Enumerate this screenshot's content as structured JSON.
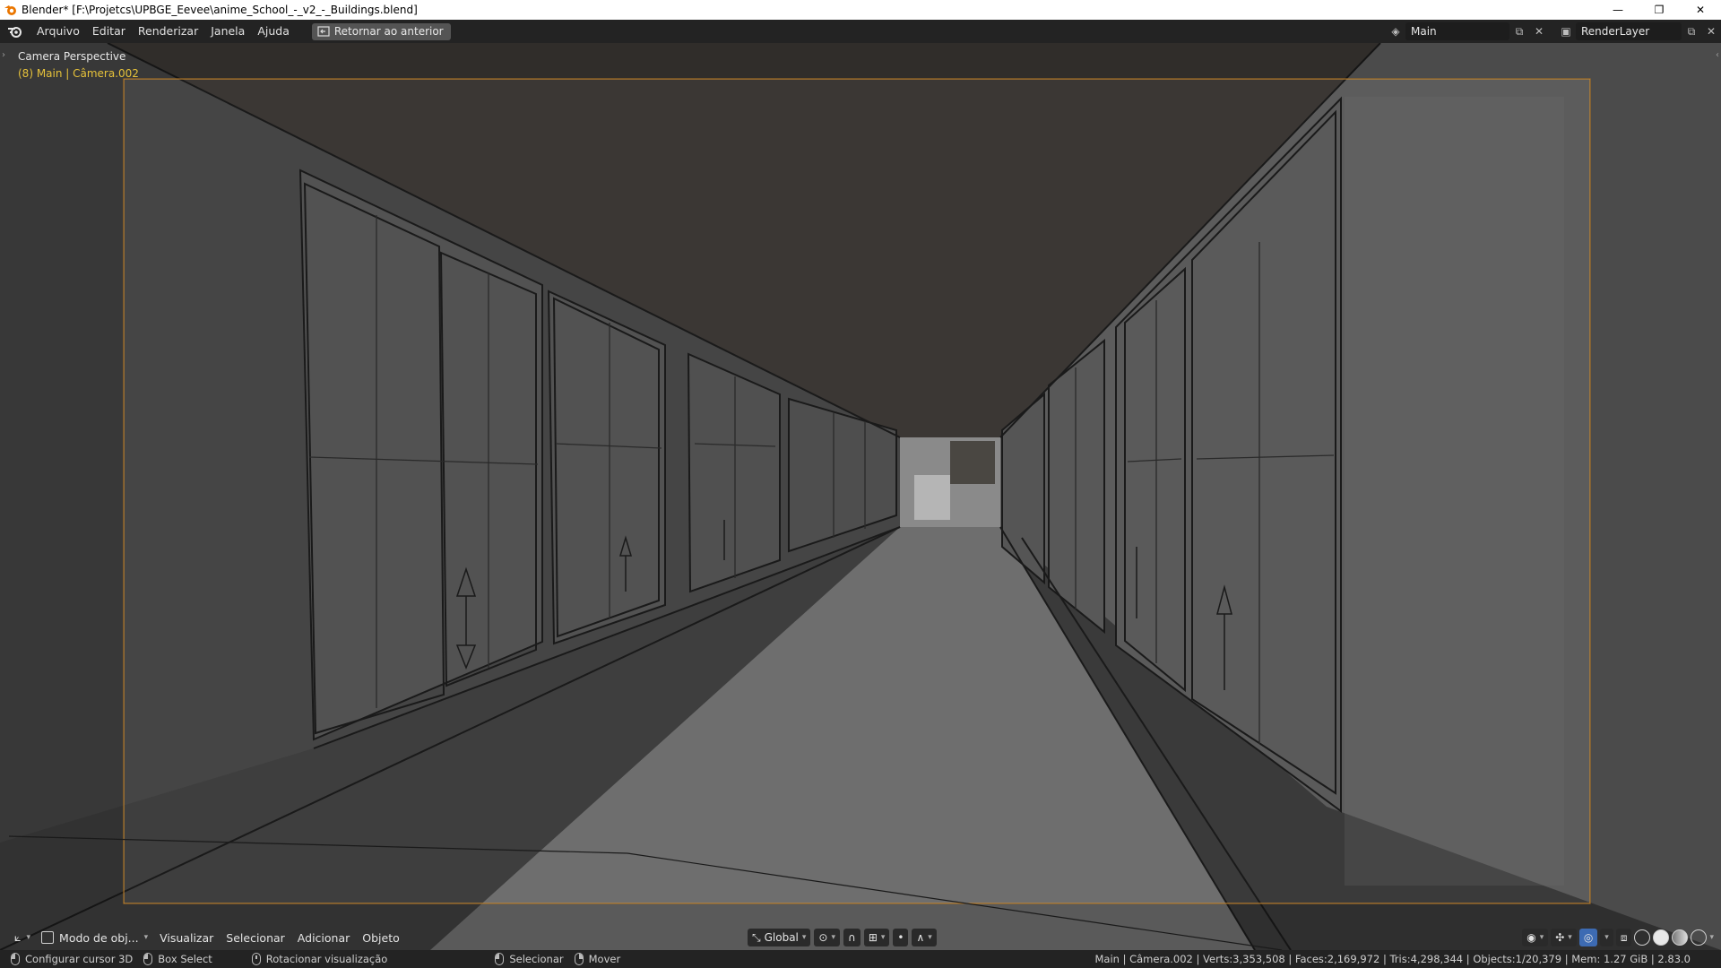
{
  "window": {
    "title": "Blender* [F:\\Projetcs\\UPBGE_Eevee\\anime_School_-_v2_-_Buildings.blend]",
    "minimize": "—",
    "restore": "❐",
    "close": "✕"
  },
  "topbar": {
    "menus": [
      "Arquivo",
      "Editar",
      "Renderizar",
      "Janela",
      "Ajuda"
    ],
    "back_button": "Retornar ao anterior",
    "scene_name": "Main",
    "view_layer": "RenderLayer"
  },
  "viewport": {
    "title": "Camera Perspective",
    "subtitle": "(8) Main | Câmera.002"
  },
  "viewport_header": {
    "mode": "Modo de obj...",
    "menus": [
      "Visualizar",
      "Selecionar",
      "Adicionar",
      "Objeto"
    ],
    "orientation": "Global"
  },
  "statusbar": {
    "hints": [
      {
        "icon": "l",
        "label": "Configurar cursor 3D"
      },
      {
        "icon": "l",
        "label": "Box Select"
      },
      {
        "icon": "m",
        "label": "Rotacionar visualização"
      },
      {
        "icon": "l",
        "label": "Selecionar"
      },
      {
        "icon": "r",
        "label": "Mover"
      }
    ],
    "stats": "Main | Câmera.002 | Verts:3,353,508 | Faces:2,169,972 | Tris:4,298,344 | Objects:1/20,379 | Mem: 1.27 GiB | 2.83.0"
  },
  "colors": {
    "accent_yellow": "#e6c23a",
    "camera_frame": "#c8872d",
    "header_bg": "#232323"
  }
}
